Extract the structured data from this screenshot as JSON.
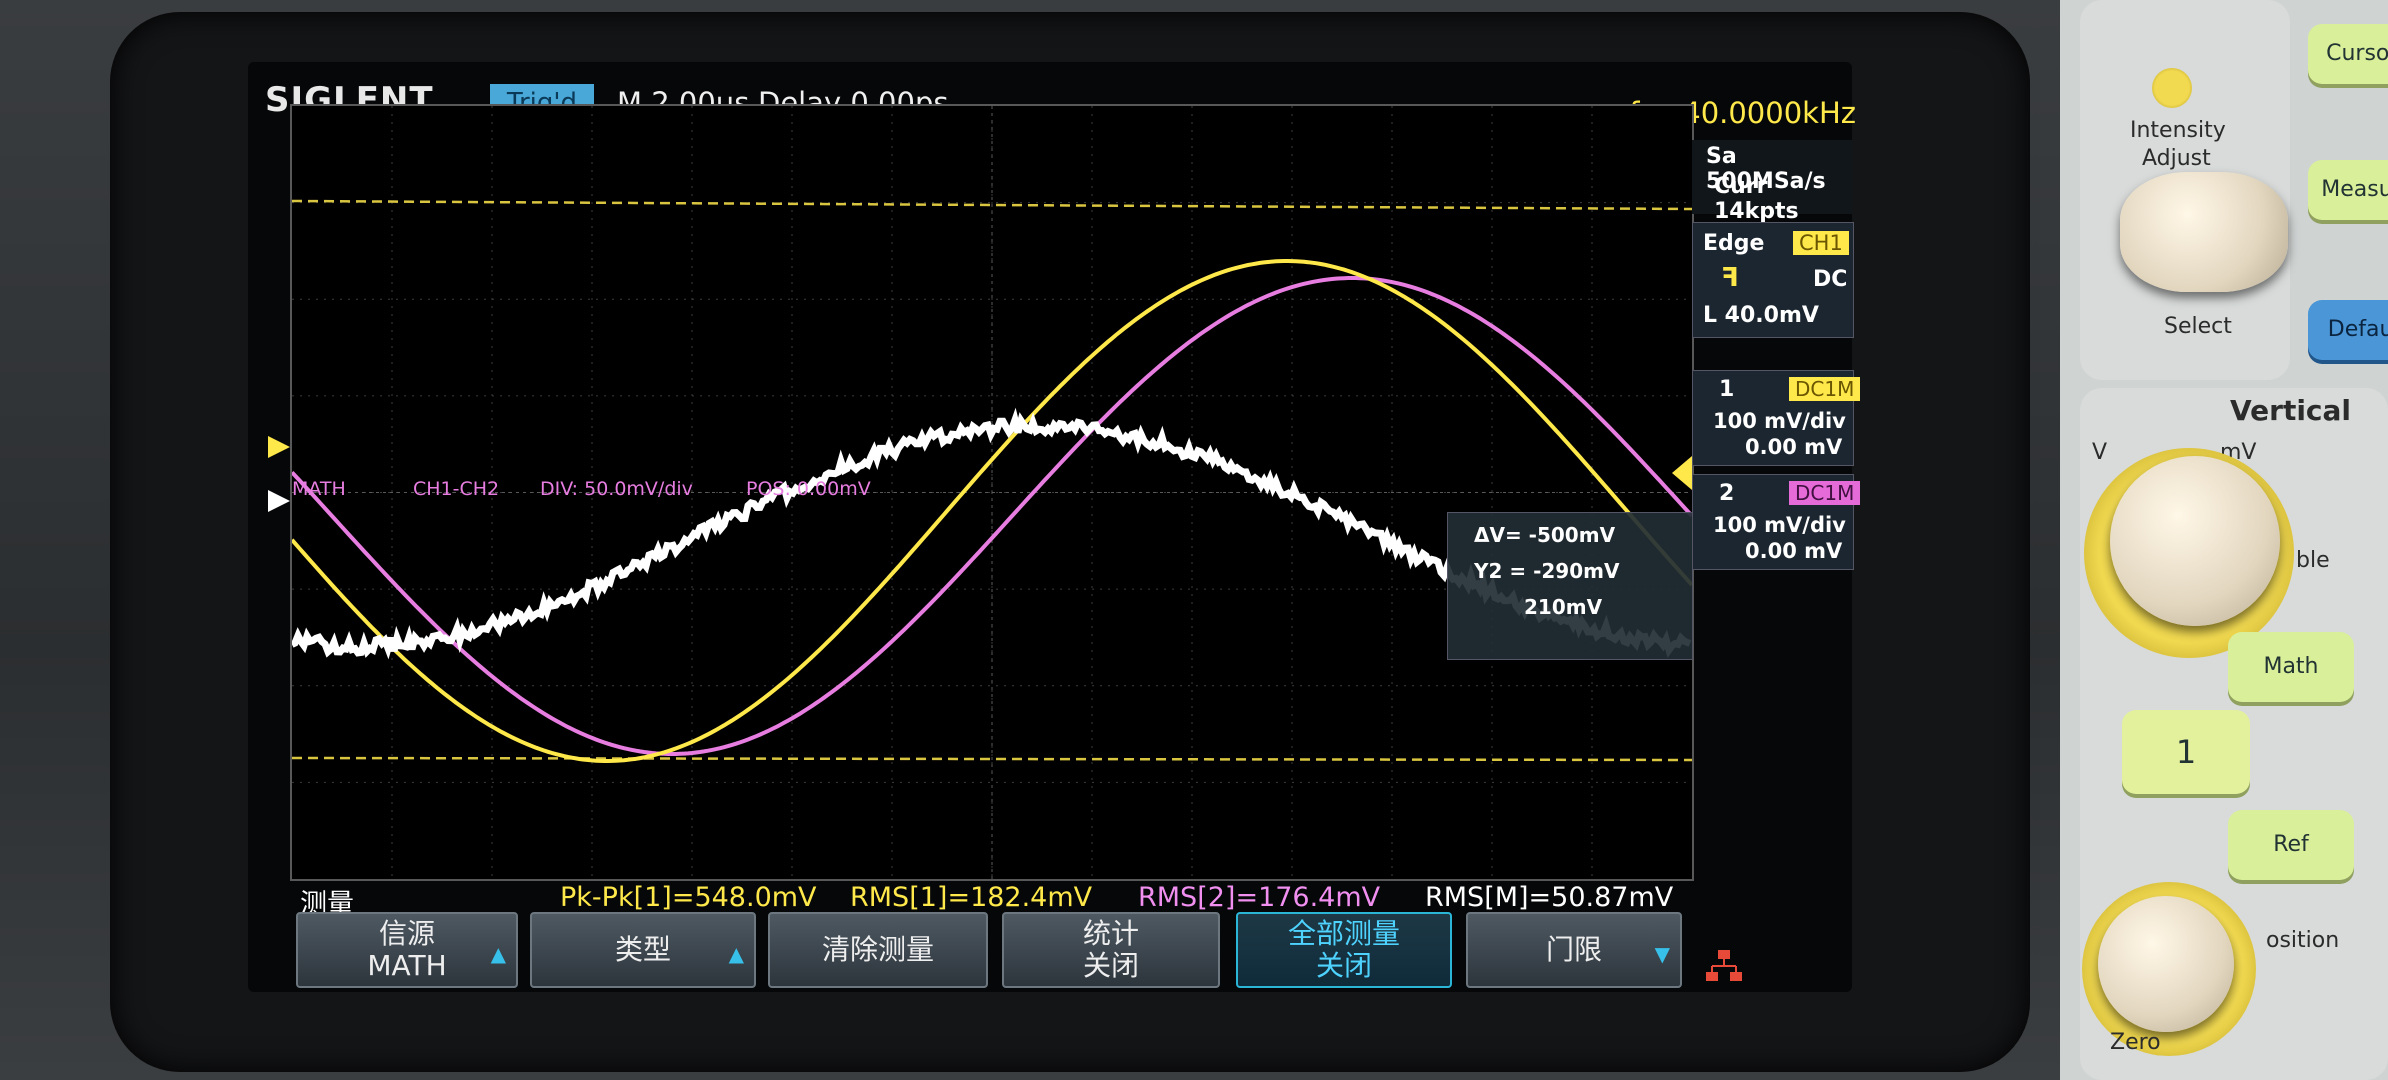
{
  "header": {
    "brand": "SIGLENT",
    "trigger_status": "Trig'd",
    "timebase": "M 2.00μs",
    "delay": "Delay 0.00ps",
    "frequency": "f = 40.0000kHz"
  },
  "acquisition": {
    "sample_rate": "Sa 500MSa/s",
    "memory": "Curr 14kpts"
  },
  "trigger": {
    "type": "Edge",
    "source": "CH1",
    "coupling": "DC",
    "level": "L  40.0mV"
  },
  "channels": [
    {
      "number": "1",
      "coupling": "DC1M",
      "scale": "100 mV/div",
      "offset": "0.00 mV"
    },
    {
      "number": "2",
      "coupling": "DC1M",
      "scale": "100 mV/div",
      "offset": "0.00 mV"
    }
  ],
  "math_info": {
    "label": "MATH",
    "expr": "CH1-CH2",
    "div": "DIV: 50.0mV/div",
    "pos": "POS: 0.00mV"
  },
  "cursor_box": {
    "delta": "ΔV= -500mV",
    "y2": "Y2 = -290mV",
    "y1": "210mV"
  },
  "measurements": {
    "title": "测量",
    "items": [
      {
        "text": "Pk-Pk[1]=548.0mV",
        "color": "#ffe84a"
      },
      {
        "text": "RMS[1]=182.4mV",
        "color": "#ffe84a"
      },
      {
        "text": "RMS[2]=176.4mV",
        "color": "#f08ff0"
      },
      {
        "text": "RMS[M]=50.87mV",
        "color": "#ffffff"
      }
    ]
  },
  "softkeys": [
    {
      "line1": "信源",
      "line2": "MATH",
      "arrow": "▲"
    },
    {
      "line1": "类型",
      "line2": "",
      "arrow": "▲"
    },
    {
      "line1": "清除测量",
      "line2": "",
      "arrow": ""
    },
    {
      "line1": "统计",
      "line2": "关闭",
      "arrow": ""
    },
    {
      "line1": "全部测量",
      "line2": "关闭",
      "arrow": ""
    },
    {
      "line1": "门限",
      "line2": "",
      "arrow": "▼"
    }
  ],
  "front_panel": {
    "cursors": "Cursors",
    "intensity": "Intensity",
    "adjust": "Adjust",
    "select": "Select",
    "measure": "Measure",
    "default": "Default",
    "vertical": "Vertical",
    "v": "V",
    "mv": "mV",
    "variable": "ble",
    "math": "Math",
    "ch1": "1",
    "ref": "Ref",
    "position": "osition",
    "zero": "Zero"
  },
  "colors": {
    "ch1": "#ffe84a",
    "ch2": "#e77de0",
    "math": "#ffffff",
    "trigger_level": "#d9c540",
    "grid": "#3d3d3d"
  }
}
